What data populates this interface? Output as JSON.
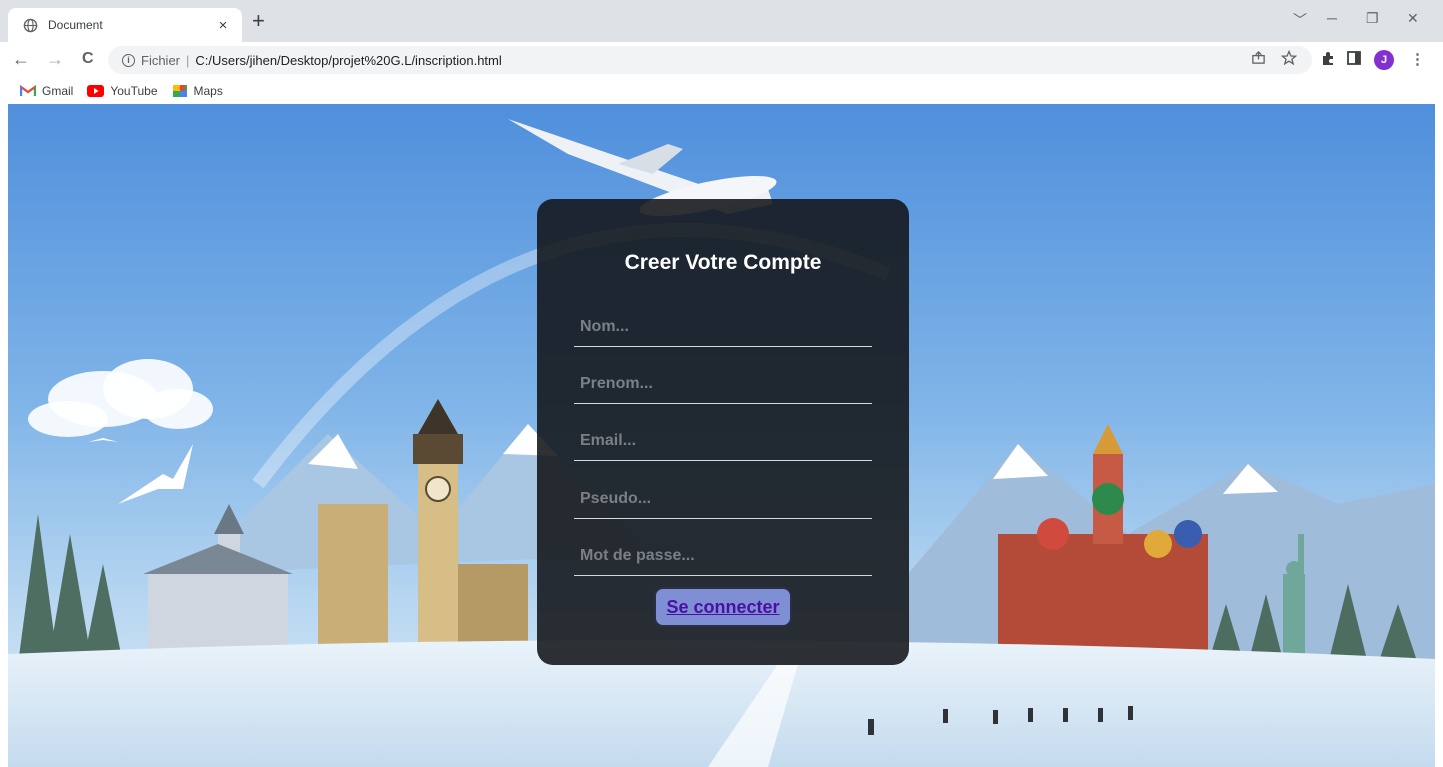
{
  "browser": {
    "tab_title": "Document",
    "tab_close": "×",
    "new_tab": "+",
    "window_controls": {
      "dropdown": "﹀",
      "minimize": "─",
      "restore": "❐",
      "close": "✕"
    },
    "nav": {
      "back": "←",
      "forward": "→",
      "reload": "C"
    },
    "address": {
      "info": "i",
      "scheme_label": "Fichier",
      "separator": "|",
      "url": "C:/Users/jihen/Desktop/projet%20G.L/inscription.html"
    },
    "profile_initial": "J",
    "menu": "⋮",
    "bookmarks": [
      {
        "label": "Gmail",
        "icon": "gmail-icon"
      },
      {
        "label": "YouTube",
        "icon": "youtube-icon"
      },
      {
        "label": "Maps",
        "icon": "maps-icon"
      }
    ]
  },
  "page": {
    "form": {
      "title": "Creer Votre Compte",
      "fields": [
        {
          "name": "nom",
          "placeholder": "Nom...",
          "value": ""
        },
        {
          "name": "prenom",
          "placeholder": "Prenom...",
          "value": ""
        },
        {
          "name": "email",
          "placeholder": "Email...",
          "value": ""
        },
        {
          "name": "pseudo",
          "placeholder": "Pseudo...",
          "value": ""
        },
        {
          "name": "password",
          "placeholder": "Mot de passe...",
          "value": ""
        }
      ],
      "submit_label": "Se connecter"
    },
    "colors": {
      "card_bg": "#121418",
      "button_bg": "#7e8fd3",
      "button_text": "#4b0fa6",
      "sky": "#5b9be0",
      "snow": "#e8f1f8"
    }
  }
}
